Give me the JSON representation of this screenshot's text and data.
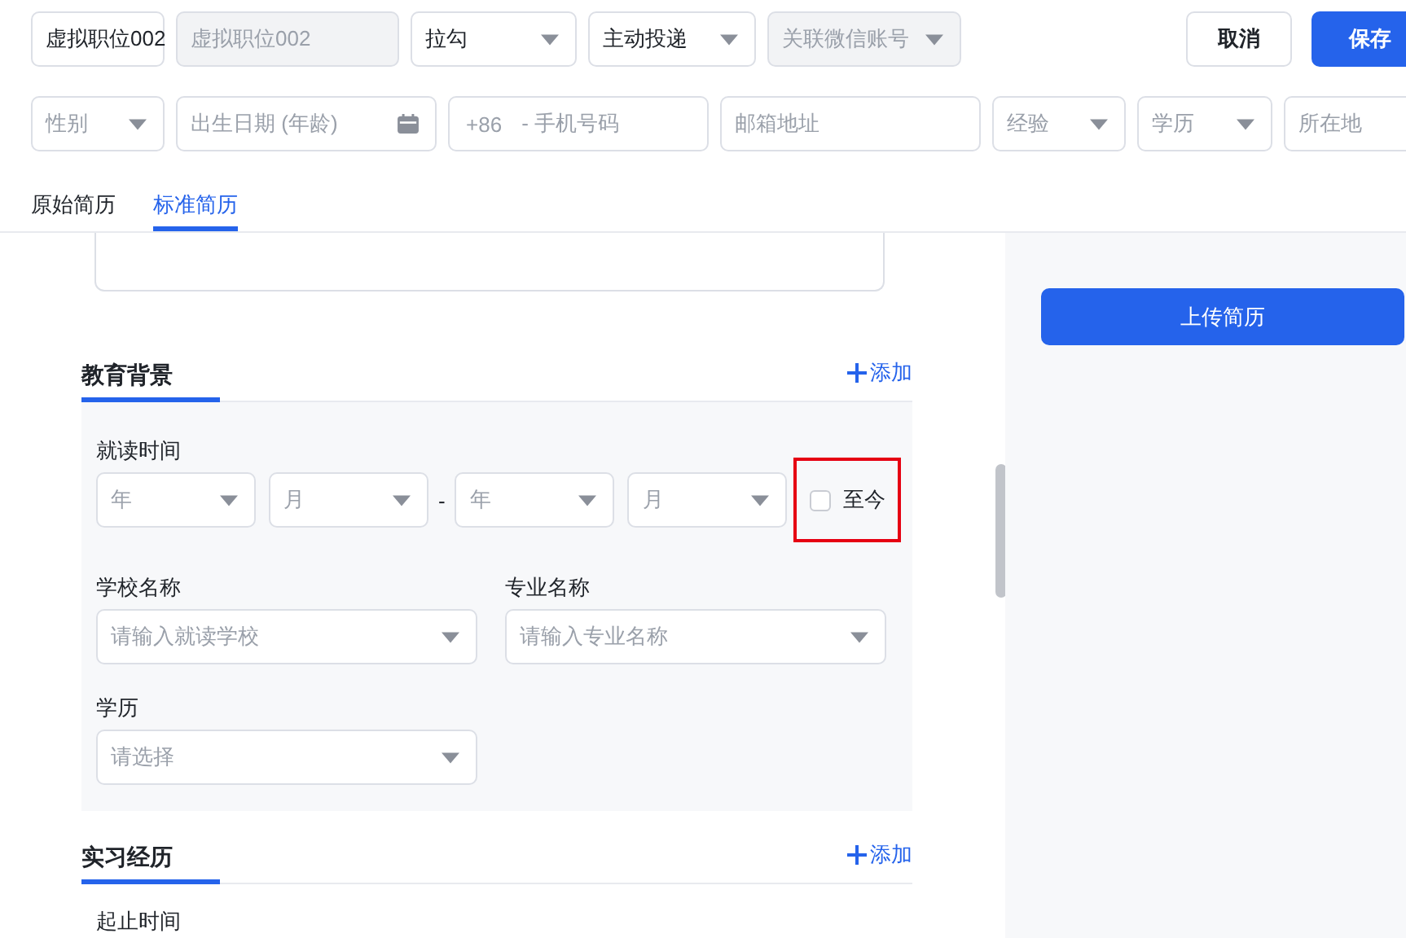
{
  "header": {
    "fields": [
      {
        "kind": "text",
        "value": "虚拟职位002",
        "disabled": false
      },
      {
        "kind": "text",
        "value": "虚拟职位002",
        "disabled": true
      },
      {
        "kind": "select",
        "value": "拉勾",
        "disabled": false
      },
      {
        "kind": "select",
        "value": "主动投递",
        "disabled": false
      },
      {
        "kind": "select",
        "placeholder": "关联微信账号",
        "disabled": true
      }
    ],
    "buttons": [
      {
        "label": "取消",
        "kind": "secondary"
      },
      {
        "label": "保存",
        "kind": "primary"
      }
    ]
  },
  "contact": [
    {
      "kind": "select",
      "placeholder": "性别"
    },
    {
      "kind": "date",
      "placeholder": "出生日期 (年龄)"
    },
    {
      "kind": "phone",
      "prefix": "+86",
      "placeholder": "- 手机号码"
    },
    {
      "kind": "text",
      "placeholder": "邮箱地址"
    },
    {
      "kind": "select",
      "placeholder": "经验"
    },
    {
      "kind": "select",
      "placeholder": "学历"
    },
    {
      "kind": "text",
      "placeholder": "所在地"
    }
  ],
  "tabs": [
    {
      "label": "原始简历",
      "selected": false
    },
    {
      "label": "标准简历",
      "selected": true
    }
  ],
  "sections": [
    {
      "title": "教育背景",
      "add_label": "添加",
      "rows": [
        {
          "kind": "date_range",
          "label": "就读时间",
          "start": [
            "年",
            "月"
          ],
          "separator": "-",
          "end": [
            "年",
            "月"
          ],
          "until_now": {
            "label": "至今",
            "checked": false,
            "highlighted": true
          }
        },
        {
          "kind": "fields",
          "fields": [
            {
              "label": "学校名称",
              "placeholder": "请输入就读学校"
            },
            {
              "label": "专业名称",
              "placeholder": "请输入专业名称"
            }
          ]
        },
        {
          "kind": "fields",
          "fields": [
            {
              "label": "学历",
              "placeholder": "请选择"
            }
          ]
        }
      ]
    },
    {
      "title": "实习经历",
      "add_label": "添加",
      "rows": [
        {
          "kind": "label_only",
          "label": "起止时间"
        }
      ]
    }
  ],
  "side": {
    "upload_button": "上传简历"
  }
}
